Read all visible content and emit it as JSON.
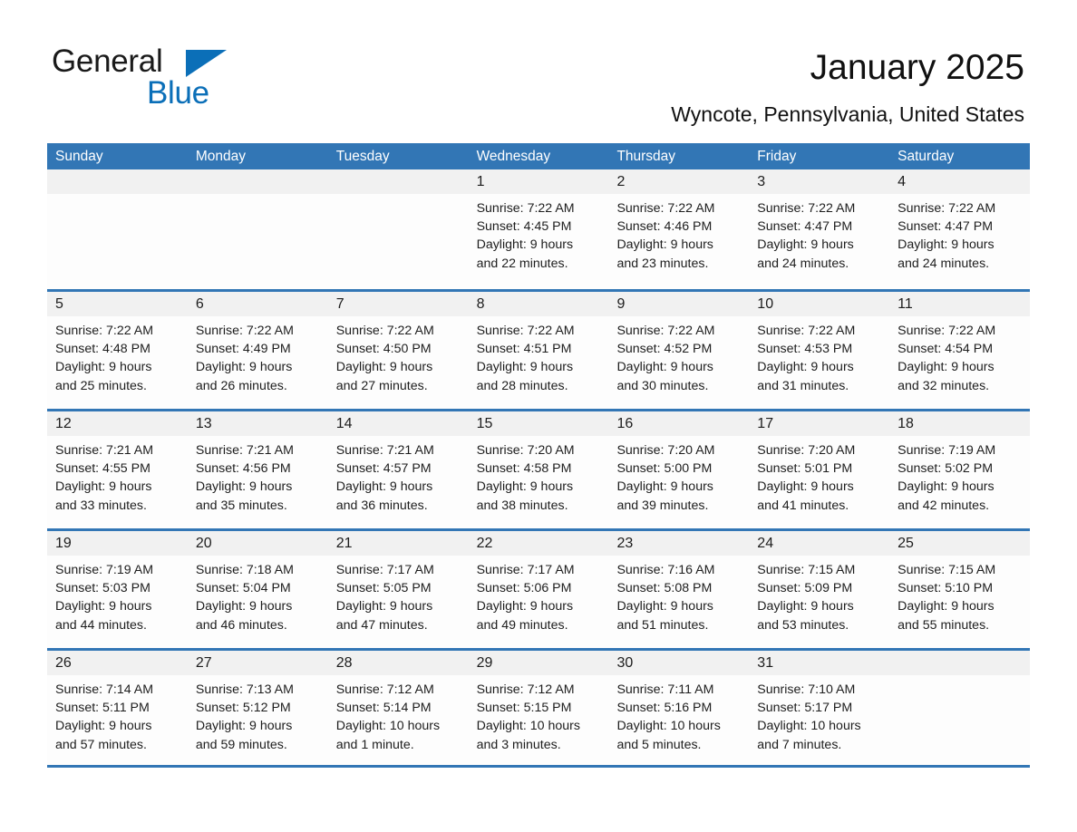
{
  "brand": {
    "name_part1": "General",
    "name_part2": "Blue",
    "accent_color": "#0b6fb8"
  },
  "header": {
    "title": "January 2025",
    "location": "Wyncote, Pennsylvania, United States",
    "header_bg_color": "#3276b5"
  },
  "weekday_headers": [
    "Sunday",
    "Monday",
    "Tuesday",
    "Wednesday",
    "Thursday",
    "Friday",
    "Saturday"
  ],
  "weeks": [
    [
      {
        "day": "",
        "lines": []
      },
      {
        "day": "",
        "lines": []
      },
      {
        "day": "",
        "lines": []
      },
      {
        "day": "1",
        "lines": [
          "Sunrise: 7:22 AM",
          "Sunset: 4:45 PM",
          "Daylight: 9 hours",
          "and 22 minutes."
        ]
      },
      {
        "day": "2",
        "lines": [
          "Sunrise: 7:22 AM",
          "Sunset: 4:46 PM",
          "Daylight: 9 hours",
          "and 23 minutes."
        ]
      },
      {
        "day": "3",
        "lines": [
          "Sunrise: 7:22 AM",
          "Sunset: 4:47 PM",
          "Daylight: 9 hours",
          "and 24 minutes."
        ]
      },
      {
        "day": "4",
        "lines": [
          "Sunrise: 7:22 AM",
          "Sunset: 4:47 PM",
          "Daylight: 9 hours",
          "and 24 minutes."
        ]
      }
    ],
    [
      {
        "day": "5",
        "lines": [
          "Sunrise: 7:22 AM",
          "Sunset: 4:48 PM",
          "Daylight: 9 hours",
          "and 25 minutes."
        ]
      },
      {
        "day": "6",
        "lines": [
          "Sunrise: 7:22 AM",
          "Sunset: 4:49 PM",
          "Daylight: 9 hours",
          "and 26 minutes."
        ]
      },
      {
        "day": "7",
        "lines": [
          "Sunrise: 7:22 AM",
          "Sunset: 4:50 PM",
          "Daylight: 9 hours",
          "and 27 minutes."
        ]
      },
      {
        "day": "8",
        "lines": [
          "Sunrise: 7:22 AM",
          "Sunset: 4:51 PM",
          "Daylight: 9 hours",
          "and 28 minutes."
        ]
      },
      {
        "day": "9",
        "lines": [
          "Sunrise: 7:22 AM",
          "Sunset: 4:52 PM",
          "Daylight: 9 hours",
          "and 30 minutes."
        ]
      },
      {
        "day": "10",
        "lines": [
          "Sunrise: 7:22 AM",
          "Sunset: 4:53 PM",
          "Daylight: 9 hours",
          "and 31 minutes."
        ]
      },
      {
        "day": "11",
        "lines": [
          "Sunrise: 7:22 AM",
          "Sunset: 4:54 PM",
          "Daylight: 9 hours",
          "and 32 minutes."
        ]
      }
    ],
    [
      {
        "day": "12",
        "lines": [
          "Sunrise: 7:21 AM",
          "Sunset: 4:55 PM",
          "Daylight: 9 hours",
          "and 33 minutes."
        ]
      },
      {
        "day": "13",
        "lines": [
          "Sunrise: 7:21 AM",
          "Sunset: 4:56 PM",
          "Daylight: 9 hours",
          "and 35 minutes."
        ]
      },
      {
        "day": "14",
        "lines": [
          "Sunrise: 7:21 AM",
          "Sunset: 4:57 PM",
          "Daylight: 9 hours",
          "and 36 minutes."
        ]
      },
      {
        "day": "15",
        "lines": [
          "Sunrise: 7:20 AM",
          "Sunset: 4:58 PM",
          "Daylight: 9 hours",
          "and 38 minutes."
        ]
      },
      {
        "day": "16",
        "lines": [
          "Sunrise: 7:20 AM",
          "Sunset: 5:00 PM",
          "Daylight: 9 hours",
          "and 39 minutes."
        ]
      },
      {
        "day": "17",
        "lines": [
          "Sunrise: 7:20 AM",
          "Sunset: 5:01 PM",
          "Daylight: 9 hours",
          "and 41 minutes."
        ]
      },
      {
        "day": "18",
        "lines": [
          "Sunrise: 7:19 AM",
          "Sunset: 5:02 PM",
          "Daylight: 9 hours",
          "and 42 minutes."
        ]
      }
    ],
    [
      {
        "day": "19",
        "lines": [
          "Sunrise: 7:19 AM",
          "Sunset: 5:03 PM",
          "Daylight: 9 hours",
          "and 44 minutes."
        ]
      },
      {
        "day": "20",
        "lines": [
          "Sunrise: 7:18 AM",
          "Sunset: 5:04 PM",
          "Daylight: 9 hours",
          "and 46 minutes."
        ]
      },
      {
        "day": "21",
        "lines": [
          "Sunrise: 7:17 AM",
          "Sunset: 5:05 PM",
          "Daylight: 9 hours",
          "and 47 minutes."
        ]
      },
      {
        "day": "22",
        "lines": [
          "Sunrise: 7:17 AM",
          "Sunset: 5:06 PM",
          "Daylight: 9 hours",
          "and 49 minutes."
        ]
      },
      {
        "day": "23",
        "lines": [
          "Sunrise: 7:16 AM",
          "Sunset: 5:08 PM",
          "Daylight: 9 hours",
          "and 51 minutes."
        ]
      },
      {
        "day": "24",
        "lines": [
          "Sunrise: 7:15 AM",
          "Sunset: 5:09 PM",
          "Daylight: 9 hours",
          "and 53 minutes."
        ]
      },
      {
        "day": "25",
        "lines": [
          "Sunrise: 7:15 AM",
          "Sunset: 5:10 PM",
          "Daylight: 9 hours",
          "and 55 minutes."
        ]
      }
    ],
    [
      {
        "day": "26",
        "lines": [
          "Sunrise: 7:14 AM",
          "Sunset: 5:11 PM",
          "Daylight: 9 hours",
          "and 57 minutes."
        ]
      },
      {
        "day": "27",
        "lines": [
          "Sunrise: 7:13 AM",
          "Sunset: 5:12 PM",
          "Daylight: 9 hours",
          "and 59 minutes."
        ]
      },
      {
        "day": "28",
        "lines": [
          "Sunrise: 7:12 AM",
          "Sunset: 5:14 PM",
          "Daylight: 10 hours",
          "and 1 minute."
        ]
      },
      {
        "day": "29",
        "lines": [
          "Sunrise: 7:12 AM",
          "Sunset: 5:15 PM",
          "Daylight: 10 hours",
          "and 3 minutes."
        ]
      },
      {
        "day": "30",
        "lines": [
          "Sunrise: 7:11 AM",
          "Sunset: 5:16 PM",
          "Daylight: 10 hours",
          "and 5 minutes."
        ]
      },
      {
        "day": "31",
        "lines": [
          "Sunrise: 7:10 AM",
          "Sunset: 5:17 PM",
          "Daylight: 10 hours",
          "and 7 minutes."
        ]
      },
      {
        "day": "",
        "lines": []
      }
    ]
  ]
}
